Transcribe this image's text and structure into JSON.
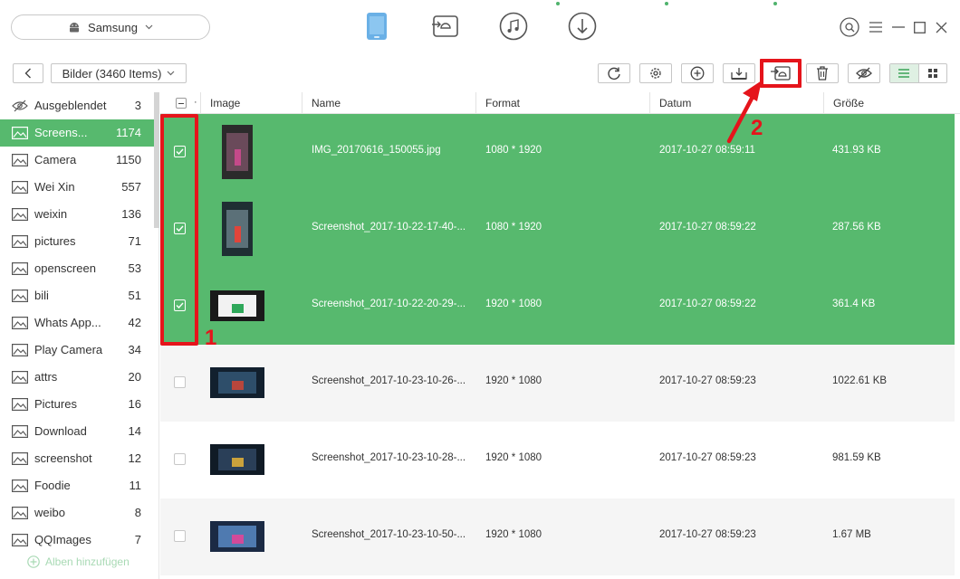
{
  "device": {
    "name": "Samsung"
  },
  "nav": {
    "items": [
      "device",
      "android-mover",
      "itunes-library",
      "downloader"
    ]
  },
  "toolbar": {
    "album_label": "Bilder (3460 Items)"
  },
  "table": {
    "select_col": "·",
    "columns": [
      "Image",
      "Name",
      "Format",
      "Datum",
      "Größe"
    ]
  },
  "sidebar": {
    "albums": [
      {
        "name": "Ausgeblendet",
        "count": "3",
        "icon": "eye-slash-icon"
      },
      {
        "name": "Screens...",
        "count": "1174",
        "icon": "image-icon"
      },
      {
        "name": "Camera",
        "count": "1150",
        "icon": "image-icon"
      },
      {
        "name": "Wei Xin",
        "count": "557",
        "icon": "image-icon"
      },
      {
        "name": "weixin",
        "count": "136",
        "icon": "image-icon"
      },
      {
        "name": "pictures",
        "count": "71",
        "icon": "image-icon"
      },
      {
        "name": "openscreen",
        "count": "53",
        "icon": "image-icon"
      },
      {
        "name": "bili",
        "count": "51",
        "icon": "image-icon"
      },
      {
        "name": "Whats App...",
        "count": "42",
        "icon": "image-icon"
      },
      {
        "name": "Play Camera",
        "count": "34",
        "icon": "image-icon"
      },
      {
        "name": "attrs",
        "count": "20",
        "icon": "image-icon"
      },
      {
        "name": "Pictures",
        "count": "16",
        "icon": "image-icon"
      },
      {
        "name": "Download",
        "count": "14",
        "icon": "image-icon"
      },
      {
        "name": "screenshot",
        "count": "12",
        "icon": "image-icon"
      },
      {
        "name": "Foodie",
        "count": "11",
        "icon": "image-icon"
      },
      {
        "name": "weibo",
        "count": "8",
        "icon": "image-icon"
      },
      {
        "name": "QQImages",
        "count": "7",
        "icon": "image-icon"
      }
    ],
    "add_album": "Alben hinzufügen"
  },
  "rows": [
    {
      "name": "IMG_20170616_150055.jpg",
      "format": "1080 * 1920",
      "date": "2017-10-27 08:59:11",
      "size": "431.93 KB",
      "selected": true
    },
    {
      "name": "Screenshot_2017-10-22-17-40-...",
      "format": "1080 * 1920",
      "date": "2017-10-27 08:59:22",
      "size": "287.56 KB",
      "selected": true
    },
    {
      "name": "Screenshot_2017-10-22-20-29-...",
      "format": "1920 * 1080",
      "date": "2017-10-27 08:59:22",
      "size": "361.4 KB",
      "selected": true
    },
    {
      "name": "Screenshot_2017-10-23-10-26-...",
      "format": "1920 * 1080",
      "date": "2017-10-27 08:59:23",
      "size": "1022.61 KB",
      "selected": false
    },
    {
      "name": "Screenshot_2017-10-23-10-28-...",
      "format": "1920 * 1080",
      "date": "2017-10-27 08:59:23",
      "size": "981.59 KB",
      "selected": false
    },
    {
      "name": "Screenshot_2017-10-23-10-50-...",
      "format": "1920 * 1080",
      "date": "2017-10-27 08:59:23",
      "size": "1.67 MB",
      "selected": false
    }
  ],
  "annotations": {
    "step1": "1",
    "step2": "2"
  },
  "colors": {
    "accent": "#57b96e",
    "annotation": "#e5141b",
    "nav_active": "#3d9ad8"
  }
}
